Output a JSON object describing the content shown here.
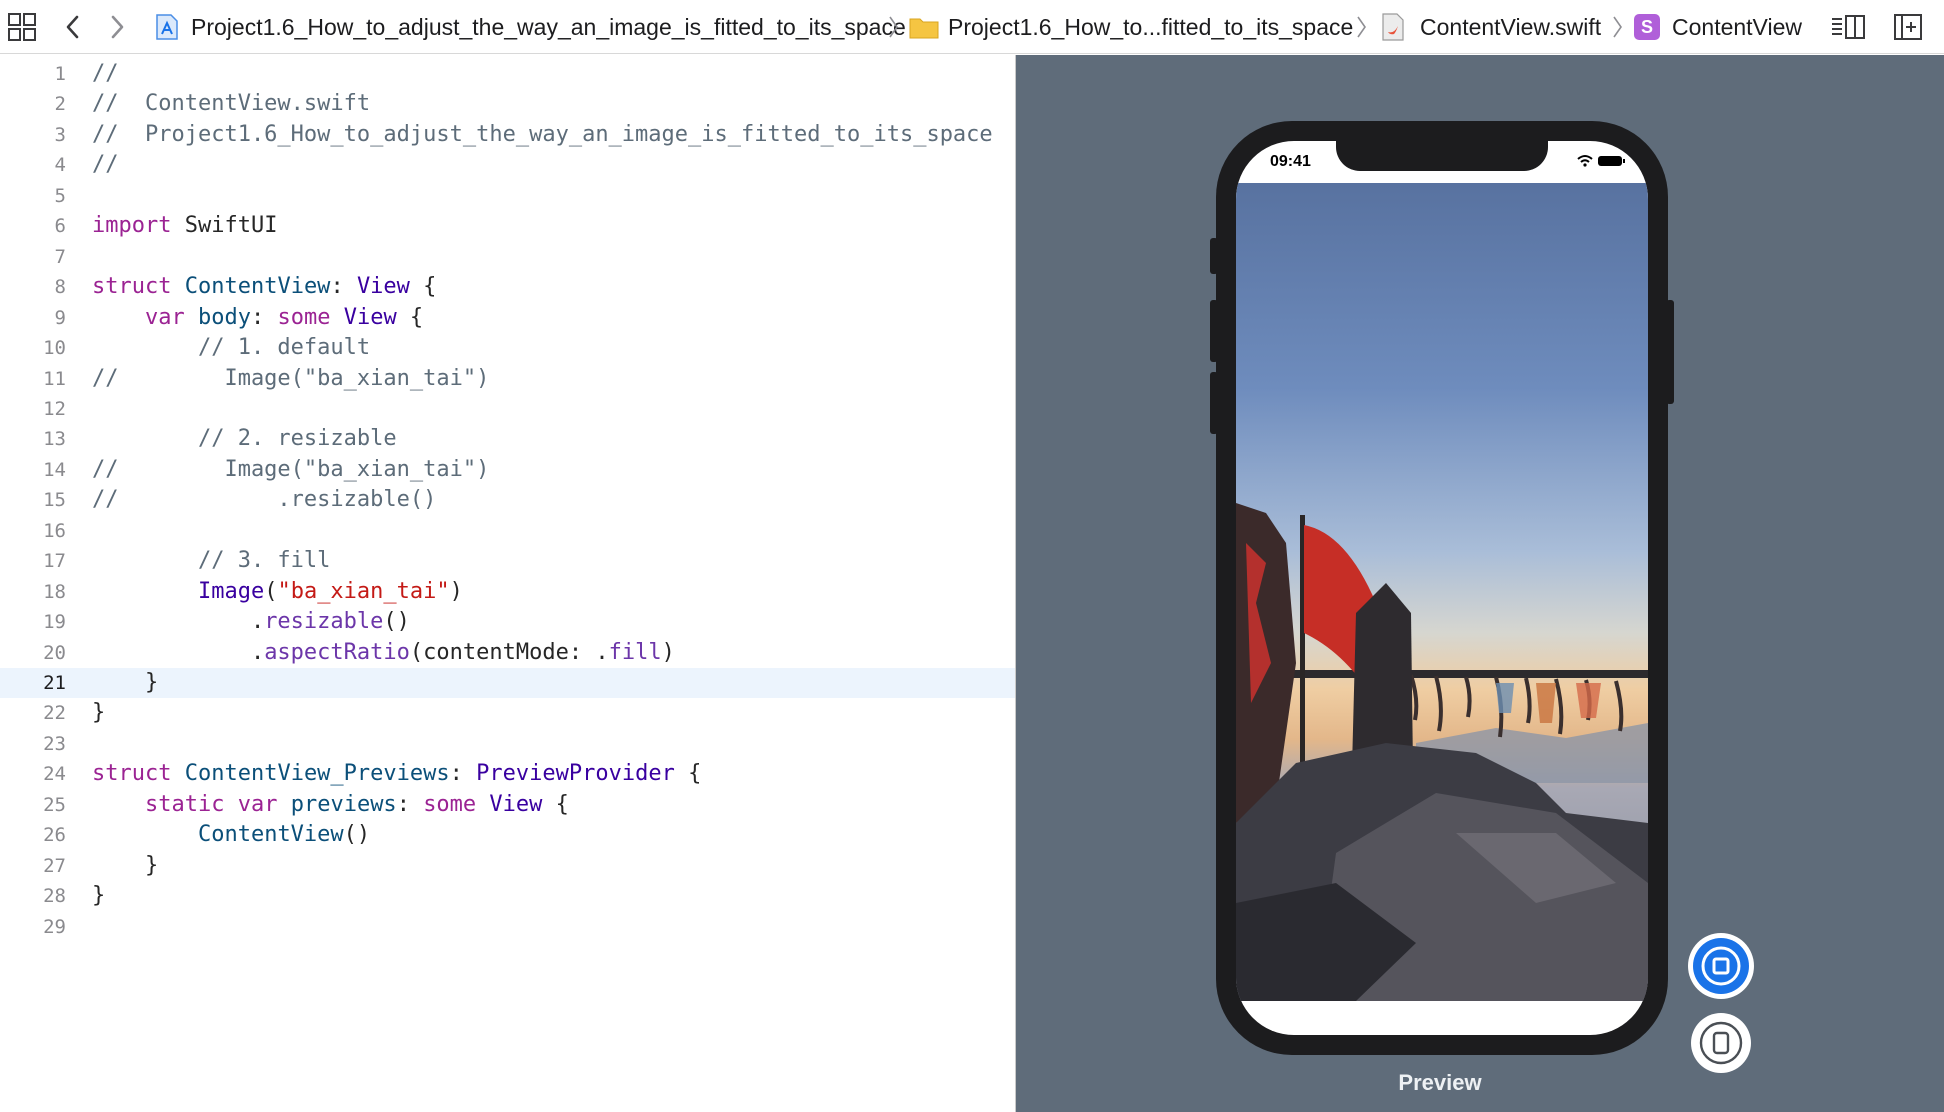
{
  "toolbar": {
    "crumbs": [
      {
        "label": "Project1.6_How_to_adjust_the_way_an_image_is_fitted_to_its_space",
        "icon": "app-project-icon"
      },
      {
        "label": "Project1.6_How_to...fitted_to_its_space",
        "icon": "folder-icon"
      },
      {
        "label": "ContentView.swift",
        "icon": "swift-file-icon"
      },
      {
        "label": "ContentView",
        "icon": "struct-s-icon"
      }
    ],
    "struct_badge": "S"
  },
  "editor": {
    "current_line": 21,
    "lines": [
      {
        "n": "1",
        "tokens": [
          {
            "c": "t-cmt",
            "t": "//"
          }
        ]
      },
      {
        "n": "2",
        "tokens": [
          {
            "c": "t-cmt",
            "t": "//  ContentView.swift"
          }
        ]
      },
      {
        "n": "3",
        "tokens": [
          {
            "c": "t-cmt",
            "t": "//  Project1.6_How_to_adjust_the_way_an_image_is_fitted_to_its_space"
          }
        ]
      },
      {
        "n": "4",
        "tokens": [
          {
            "c": "t-cmt",
            "t": "//"
          }
        ]
      },
      {
        "n": "5",
        "tokens": []
      },
      {
        "n": "6",
        "tokens": [
          {
            "c": "t-kw",
            "t": "import"
          },
          {
            "c": "t-pl",
            "t": " SwiftUI"
          }
        ]
      },
      {
        "n": "7",
        "tokens": []
      },
      {
        "n": "8",
        "tokens": [
          {
            "c": "t-kw",
            "t": "struct"
          },
          {
            "c": "t-pl",
            "t": " "
          },
          {
            "c": "t-typ",
            "t": "ContentView"
          },
          {
            "c": "t-pl",
            "t": ": "
          },
          {
            "c": "t-cls",
            "t": "View"
          },
          {
            "c": "t-pl",
            "t": " {"
          }
        ]
      },
      {
        "n": "9",
        "tokens": [
          {
            "c": "t-pl",
            "t": "    "
          },
          {
            "c": "t-kw",
            "t": "var"
          },
          {
            "c": "t-pl",
            "t": " "
          },
          {
            "c": "t-typ",
            "t": "body"
          },
          {
            "c": "t-pl",
            "t": ": "
          },
          {
            "c": "t-kw",
            "t": "some"
          },
          {
            "c": "t-pl",
            "t": " "
          },
          {
            "c": "t-cls",
            "t": "View"
          },
          {
            "c": "t-pl",
            "t": " {"
          }
        ]
      },
      {
        "n": "10",
        "tokens": [
          {
            "c": "t-cmt",
            "t": "        // 1. default"
          }
        ]
      },
      {
        "n": "11",
        "tokens": [
          {
            "c": "t-cmt",
            "t": "//        Image(\"ba_xian_tai\")"
          }
        ]
      },
      {
        "n": "12",
        "tokens": []
      },
      {
        "n": "13",
        "tokens": [
          {
            "c": "t-cmt",
            "t": "        // 2. resizable"
          }
        ]
      },
      {
        "n": "14",
        "tokens": [
          {
            "c": "t-cmt",
            "t": "//        Image(\"ba_xian_tai\")"
          }
        ]
      },
      {
        "n": "15",
        "tokens": [
          {
            "c": "t-cmt",
            "t": "//            .resizable()"
          }
        ]
      },
      {
        "n": "16",
        "tokens": []
      },
      {
        "n": "17",
        "tokens": [
          {
            "c": "t-cmt",
            "t": "        // 3. fill"
          }
        ]
      },
      {
        "n": "18",
        "tokens": [
          {
            "c": "t-pl",
            "t": "        "
          },
          {
            "c": "t-cls",
            "t": "Image"
          },
          {
            "c": "t-pl",
            "t": "("
          },
          {
            "c": "t-str",
            "t": "\"ba_xian_tai\""
          },
          {
            "c": "t-pl",
            "t": ")"
          }
        ]
      },
      {
        "n": "19",
        "tokens": [
          {
            "c": "t-pl",
            "t": "            ."
          },
          {
            "c": "t-fn",
            "t": "resizable"
          },
          {
            "c": "t-pl",
            "t": "()"
          }
        ]
      },
      {
        "n": "20",
        "tokens": [
          {
            "c": "t-pl",
            "t": "            ."
          },
          {
            "c": "t-fn",
            "t": "aspectRatio"
          },
          {
            "c": "t-pl",
            "t": "(contentMode: ."
          },
          {
            "c": "t-fn",
            "t": "fill"
          },
          {
            "c": "t-pl",
            "t": ")"
          }
        ]
      },
      {
        "n": "21",
        "tokens": [
          {
            "c": "t-pl",
            "t": "    }"
          }
        ]
      },
      {
        "n": "22",
        "tokens": [
          {
            "c": "t-pl",
            "t": "}"
          }
        ]
      },
      {
        "n": "23",
        "tokens": []
      },
      {
        "n": "24",
        "tokens": [
          {
            "c": "t-kw",
            "t": "struct"
          },
          {
            "c": "t-pl",
            "t": " "
          },
          {
            "c": "t-typ",
            "t": "ContentView_Previews"
          },
          {
            "c": "t-pl",
            "t": ": "
          },
          {
            "c": "t-cls",
            "t": "PreviewProvider"
          },
          {
            "c": "t-pl",
            "t": " {"
          }
        ]
      },
      {
        "n": "25",
        "tokens": [
          {
            "c": "t-pl",
            "t": "    "
          },
          {
            "c": "t-kw",
            "t": "static"
          },
          {
            "c": "t-pl",
            "t": " "
          },
          {
            "c": "t-kw",
            "t": "var"
          },
          {
            "c": "t-pl",
            "t": " "
          },
          {
            "c": "t-typ",
            "t": "previews"
          },
          {
            "c": "t-pl",
            "t": ": "
          },
          {
            "c": "t-kw",
            "t": "some"
          },
          {
            "c": "t-pl",
            "t": " "
          },
          {
            "c": "t-cls",
            "t": "View"
          },
          {
            "c": "t-pl",
            "t": " {"
          }
        ]
      },
      {
        "n": "26",
        "tokens": [
          {
            "c": "t-pl",
            "t": "        "
          },
          {
            "c": "t-typ",
            "t": "ContentView"
          },
          {
            "c": "t-pl",
            "t": "()"
          }
        ]
      },
      {
        "n": "27",
        "tokens": [
          {
            "c": "t-pl",
            "t": "    }"
          }
        ]
      },
      {
        "n": "28",
        "tokens": [
          {
            "c": "t-pl",
            "t": "}"
          }
        ]
      },
      {
        "n": "29",
        "tokens": []
      }
    ]
  },
  "preview": {
    "status_time": "09:41",
    "label": "Preview",
    "live_button_icon": "live-preview-icon",
    "device_button_icon": "device-settings-icon",
    "colors": {
      "canvas": "#5f6c7a",
      "accent": "#1a73e8"
    }
  }
}
